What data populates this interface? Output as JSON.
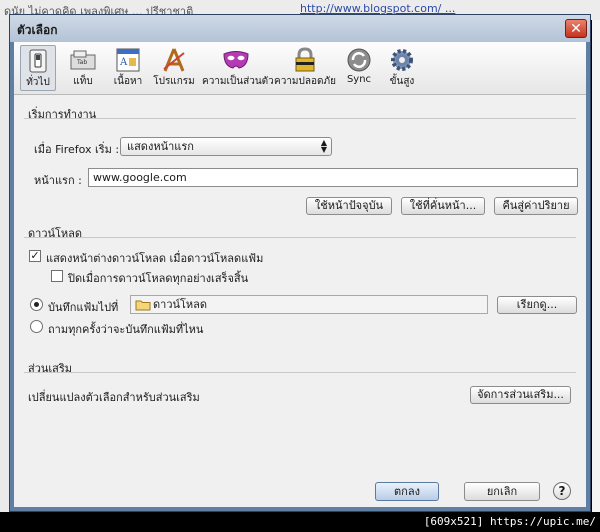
{
  "background": {
    "left_text": "ดนัย ไม่คาดคิด เพลงพิเศษ ... ปรีชาชาติ",
    "url_text": "http://www.blogspot.com/ ... "
  },
  "window": {
    "title": "ตัวเลือก",
    "close_glyph": "✕"
  },
  "toolbar": {
    "panes": [
      {
        "label": "ทั่วไป",
        "icon": "switch-icon",
        "selected": true
      },
      {
        "label": "แท็บ",
        "icon": "tab-icon",
        "selected": false
      },
      {
        "label": "เนื้อหา",
        "icon": "content-icon",
        "selected": false
      },
      {
        "label": "โปรแกรม",
        "icon": "applications-icon",
        "selected": false
      },
      {
        "label": "ความเป็นส่วนตัว",
        "icon": "mask-icon",
        "selected": false
      },
      {
        "label": "ความปลอดภัย",
        "icon": "padlock-icon",
        "selected": false
      },
      {
        "label": "Sync",
        "icon": "sync-icon",
        "selected": false
      },
      {
        "label": "ขั้นสูง",
        "icon": "gear-icon",
        "selected": false
      }
    ]
  },
  "startup": {
    "heading": "เริ่มการทำงาน",
    "when_label": "เมื่อ Firefox เริ่ม :",
    "when_value": "แสดงหน้าแรก",
    "homepage_label": "หน้าแรก :",
    "homepage_value": "www.google.com",
    "btn_use_current": "ใช้หน้าปัจจุบัน",
    "btn_use_bookmark": "ใช้ที่คั่นหน้า...",
    "btn_restore_default": "คืนสู่ค่าปริยาย"
  },
  "downloads": {
    "heading": "ดาวน์โหลด",
    "show_window_label": "แสดงหน้าต่างดาวน์โหลด เมื่อดาวน์โหลดแฟ้ม",
    "show_window_checked": true,
    "close_when_done_label": "ปิดเมื่อการดาวน์โหลดทุกอย่างเสร็จสิ้น",
    "close_when_done_checked": false,
    "save_to_label": "บันทึกแฟ้มไปที่",
    "save_to_selected": true,
    "folder_name": "ดาวน์โหลด",
    "browse_button": "เรียกดู...",
    "ask_label": "ถามทุกครั้งว่าจะบันทึกแฟ้มที่ไหน",
    "ask_selected": false
  },
  "addons": {
    "heading": "ส่วนเสริม",
    "description": "เปลี่ยนแปลงตัวเลือกสำหรับส่วนเสริม",
    "manage_button": "จัดการส่วนเสริม..."
  },
  "footer": {
    "ok": "ตกลง",
    "cancel": "ยกเลิก",
    "help": "?"
  },
  "badge": "[609x521] https://upic.me/"
}
